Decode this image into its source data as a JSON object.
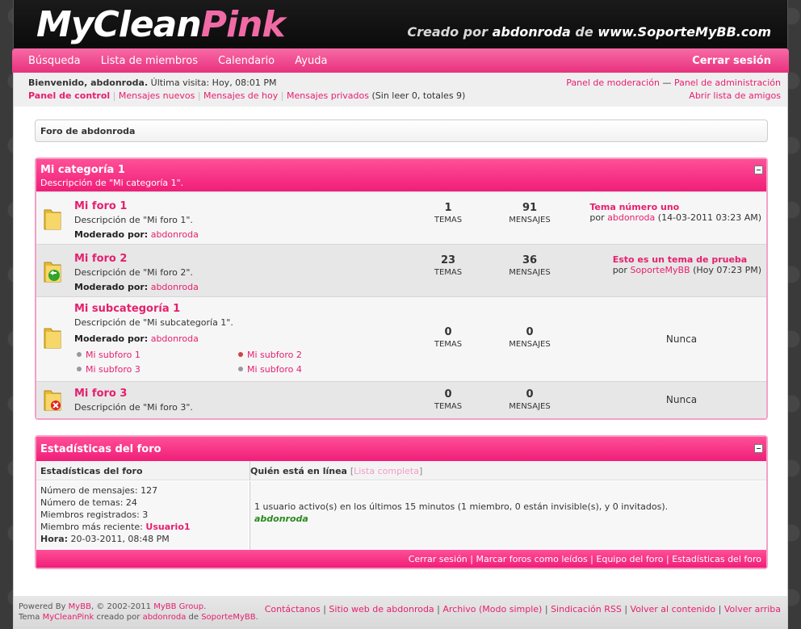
{
  "header": {
    "logo_part1": "MyClean",
    "logo_part2": "Pink",
    "tagline_prefix": "Creado por",
    "tagline_author": "abdonroda",
    "tagline_mid": "de",
    "tagline_site": "www.SoporteMyBB.com"
  },
  "menu": {
    "items": [
      "Búsqueda",
      "Lista de miembros",
      "Calendario",
      "Ayuda"
    ],
    "logout": "Cerrar sesión"
  },
  "panel": {
    "welcome": "Bienvenido, abdonroda.",
    "last_visit": "Última visita: Hoy, 08:01 PM",
    "control": "Panel de control",
    "new_posts": "Mensajes nuevos",
    "today_posts": "Mensajes de hoy",
    "pms": "Mensajes privados",
    "pms_stats": "(Sin leer 0, totales 9)",
    "mod_panel": "Panel de moderación",
    "dash": "—",
    "admin_panel": "Panel de administración",
    "buddy_list": "Abrir lista de amigos"
  },
  "breadcrumb": "Foro de abdonroda",
  "category": {
    "title": "Mi categoría 1",
    "description": "Descripción de \"Mi categoría 1\".",
    "forums": [
      {
        "name": "Mi foro 1",
        "description": "Descripción de \"Mi foro 1\".",
        "mod_label": "Moderado por:",
        "moderator": "abdonroda",
        "threads": "1",
        "posts": "91",
        "last_title": "Tema número uno",
        "last_by": "por",
        "last_user": "abdonroda",
        "last_date": "(14-03-2011 03:23 AM)"
      },
      {
        "name": "Mi foro 2",
        "description": "Descripción de \"Mi foro 2\".",
        "mod_label": "Moderado por:",
        "moderator": "abdonroda",
        "threads": "23",
        "posts": "36",
        "last_title": "Esto es un tema de prueba",
        "last_by": "por",
        "last_user": "SoporteMyBB",
        "last_date": "(Hoy 07:23 PM)"
      },
      {
        "name": "Mi subcategoría 1",
        "description": "Descripción de \"Mi subcategoría 1\".",
        "mod_label": "Moderado por:",
        "moderator": "abdonroda",
        "threads": "0",
        "posts": "0",
        "last": "Nunca",
        "subforums": [
          "Mi subforo 1",
          "Mi subforo 2",
          "Mi subforo 3",
          "Mi subforo 4"
        ]
      },
      {
        "name": "Mi foro 3",
        "description": "Descripción de \"Mi foro 3\".",
        "threads": "0",
        "posts": "0",
        "last": "Nunca"
      }
    ],
    "threads_label": "TEMAS",
    "posts_label": "MENSAJES"
  },
  "stats": {
    "title": "Estadísticas del foro",
    "col1": "Estadísticas del foro",
    "col2": "Quién está en línea",
    "full_list": "Lista completa",
    "lines": [
      "Número de mensajes: 127",
      "Número de temas: 24",
      "Miembros registrados: 3"
    ],
    "newest_label": "Miembro más reciente:",
    "newest": "Usuario1",
    "time_label": "Hora:",
    "time": "20-03-2011, 08:48 PM",
    "online": "1 usuario activo(s) en los últimos 15 minutos (1 miembro, 0 están invisible(s), y 0 invitados).",
    "online_user": "abdonroda",
    "footer_links": [
      "Cerrar sesión",
      "Marcar foros como leídos",
      "Equipo del foro",
      "Estadísticas del foro"
    ]
  },
  "bottom": {
    "powered": "Powered By",
    "mybb": "MyBB",
    "copy": ", © 2002-2011",
    "group": "MyBB Group",
    "theme": "Tema",
    "theme_name": "MyCleanPink",
    "created": "creado por",
    "author": "abdonroda",
    "de": "de",
    "site": "SoporteMyBB",
    "links": [
      "Contáctanos",
      "Sitio web de abdonroda",
      "Archivo (Modo simple)",
      "Sindicación RSS",
      "Volver al contenido",
      "Volver arriba"
    ]
  },
  "colors": {
    "accent": "#f01e78",
    "link": "#e61f6e",
    "online": "#2a8a1e"
  },
  "icons": [
    "folder-icon",
    "folder-redirect-icon",
    "folder-locked-icon",
    "collapse-icon"
  ]
}
